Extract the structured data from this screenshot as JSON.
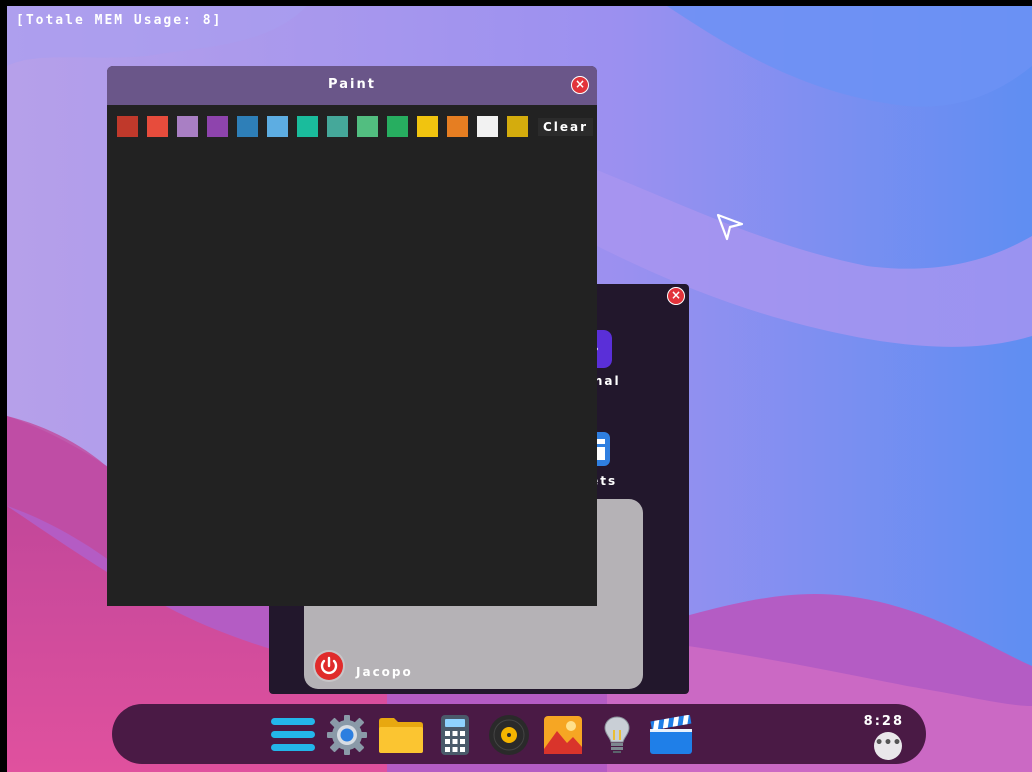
{
  "system": {
    "mem_label": "[Totale MEM Usage: 8]"
  },
  "paint": {
    "title": "Paint",
    "clear_label": "Clear",
    "palette": [
      "#c0392b",
      "#e74c3c",
      "#a97fc4",
      "#8e44ad",
      "#2e7fb8",
      "#5dade2",
      "#1abc9c",
      "#45a89a",
      "#52be80",
      "#27ae60",
      "#f1c40f",
      "#e67e22",
      "#f2f2f2",
      "#d4ac0d"
    ]
  },
  "launcher": {
    "apps": [
      {
        "label": "rminal",
        "icon": "terminal-icon"
      },
      {
        "label": "dgets",
        "icon": "widgets-icon"
      }
    ],
    "user_name": "Jacopo"
  },
  "dock": {
    "icons": [
      "menu-icon",
      "settings-gear-icon",
      "folder-icon",
      "calculator-icon",
      "music-disc-icon",
      "photos-icon",
      "lightbulb-icon",
      "video-clapper-icon"
    ],
    "clock": "8:28",
    "more_label": "•••"
  },
  "colors": {
    "paint_titlebar": "#6a5689",
    "dock_bg": "#4a1a45",
    "close_red": "#e2333b"
  }
}
